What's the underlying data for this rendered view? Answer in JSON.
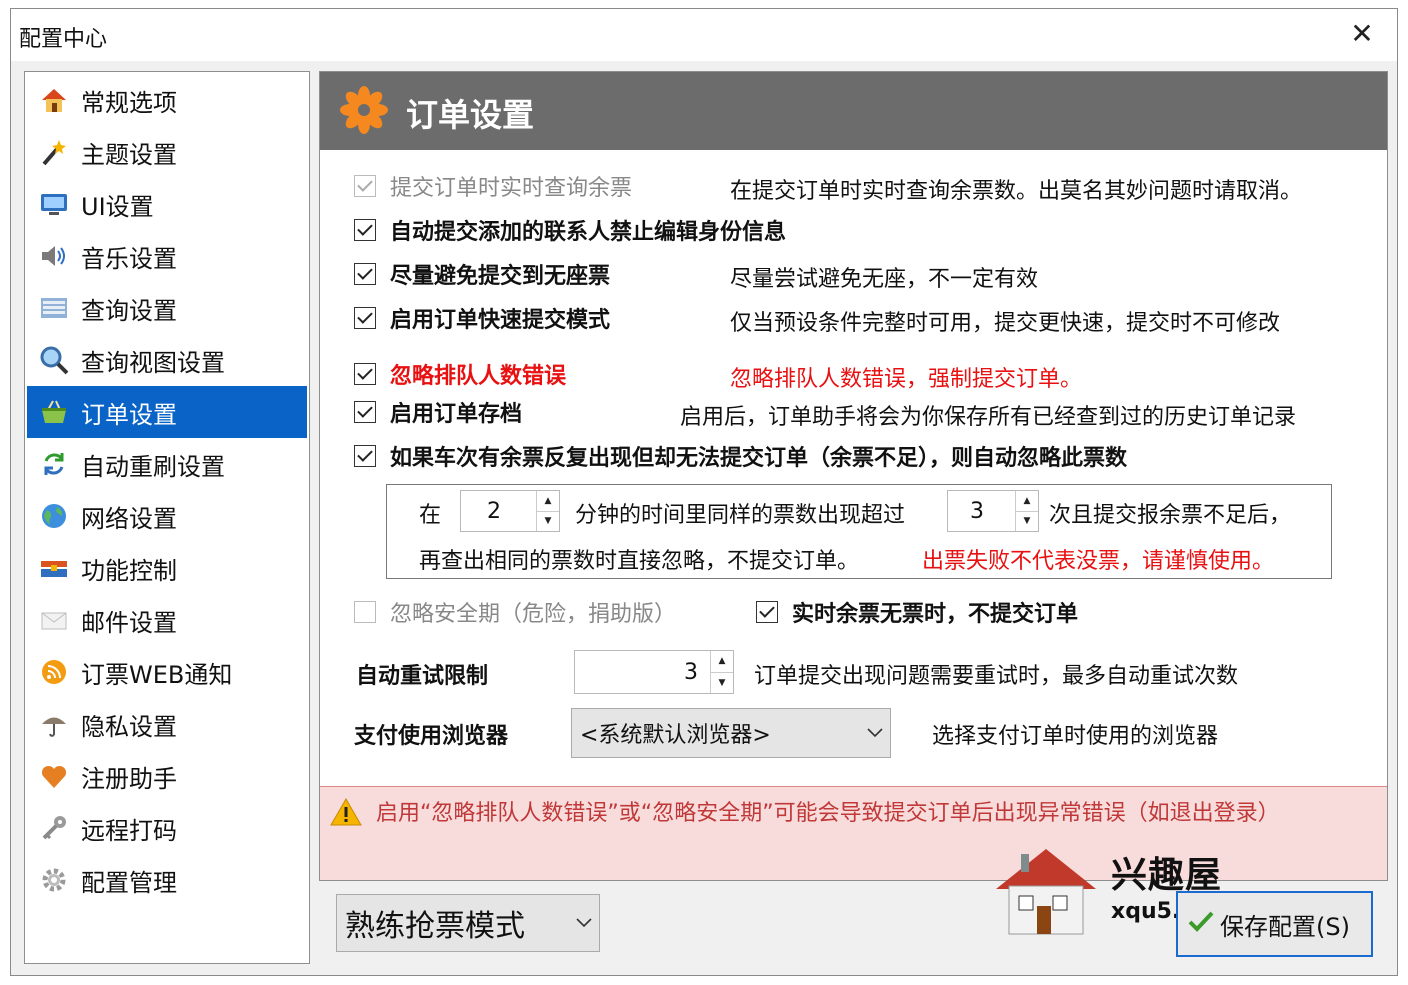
{
  "window": {
    "title": "配置中心",
    "close_glyph": "✕"
  },
  "sidebar": {
    "selected_index": 6,
    "items": [
      {
        "label": "常规选项",
        "icon": "home-icon"
      },
      {
        "label": "主题设置",
        "icon": "magic-wand-icon"
      },
      {
        "label": "UI设置",
        "icon": "monitor-icon"
      },
      {
        "label": "音乐设置",
        "icon": "speaker-icon"
      },
      {
        "label": "查询设置",
        "icon": "screen-icon"
      },
      {
        "label": "查询视图设置",
        "icon": "magnifier-icon"
      },
      {
        "label": "订单设置",
        "icon": "basket-icon"
      },
      {
        "label": "自动重刷设置",
        "icon": "refresh-icon"
      },
      {
        "label": "网络设置",
        "icon": "globe-icon"
      },
      {
        "label": "功能控制",
        "icon": "toolbox-icon"
      },
      {
        "label": "邮件设置",
        "icon": "mail-icon"
      },
      {
        "label": "订票WEB通知",
        "icon": "rss-icon"
      },
      {
        "label": "隐私设置",
        "icon": "umbrella-icon"
      },
      {
        "label": "注册助手",
        "icon": "heart-icon"
      },
      {
        "label": "远程打码",
        "icon": "key-icon"
      },
      {
        "label": "配置管理",
        "icon": "cog-icon"
      }
    ]
  },
  "panel": {
    "title": "订单设置",
    "options": [
      {
        "label": "提交订单时实时查询余票",
        "desc": "在提交订单时实时查询余票数。出莫名其妙问题时请取消。",
        "checked": true,
        "disabled": true
      },
      {
        "label": "自动提交添加的联系人禁止编辑身份信息",
        "desc": "",
        "checked": true,
        "disabled": false
      },
      {
        "label": "尽量避免提交到无座票",
        "desc": "尽量尝试避免无座，不一定有效",
        "checked": true,
        "disabled": false
      },
      {
        "label": "启用订单快速提交模式",
        "desc": "仅当预设条件完整时可用，提交更快速，提交时不可修改",
        "checked": true,
        "disabled": false
      },
      {
        "label": "忽略排队人数错误",
        "desc": "忽略排队人数错误，强制提交订单。",
        "checked": true,
        "disabled": false
      },
      {
        "label": "启用订单存档",
        "desc": "启用后，订单助手将会为你保存所有已经查到过的历史订单记录",
        "checked": true,
        "disabled": false
      },
      {
        "label": "如果车次有余票反复出现但却无法提交订单（余票不足），则自动忽略此票数",
        "desc": "",
        "checked": true,
        "disabled": false
      }
    ],
    "group": {
      "t_in": "在",
      "minutes": "2",
      "t_mid": "分钟的时间里同样的票数出现超过",
      "times": "3",
      "t_end": "次且提交报余票不足后，",
      "line2": "再查出相同的票数时直接忽略，不提交订单。",
      "line2_warn": "出票失败不代表没票，请谨慎使用。"
    },
    "ignore_safe": {
      "label": "忽略安全期（危险，捐助版）",
      "checked": false,
      "disabled": true
    },
    "no_ticket": {
      "label": "实时余票无票时，不提交订单",
      "checked": true
    },
    "retry": {
      "label": "自动重试限制",
      "value": "3",
      "desc": "订单提交出现问题需要重试时，最多自动重试次数"
    },
    "browser": {
      "label": "支付使用浏览器",
      "value": "<系统默认浏览器>",
      "desc": "选择支付订单时使用的浏览器"
    },
    "warning": "启用“忽略排队人数错误”或“忽略安全期”可能会导致提交订单后出现异常错误（如退出登录）"
  },
  "footer": {
    "mode": "熟练抢票模式",
    "save": "保存配置(S)"
  },
  "watermark": {
    "cn": "兴趣屋",
    "url": "xqu5.com"
  },
  "colors": {
    "selected": "#0a64c8",
    "warning_red": "#e81010",
    "header_gray": "#6c6c6c",
    "warn_bg": "#f8dcdc"
  }
}
